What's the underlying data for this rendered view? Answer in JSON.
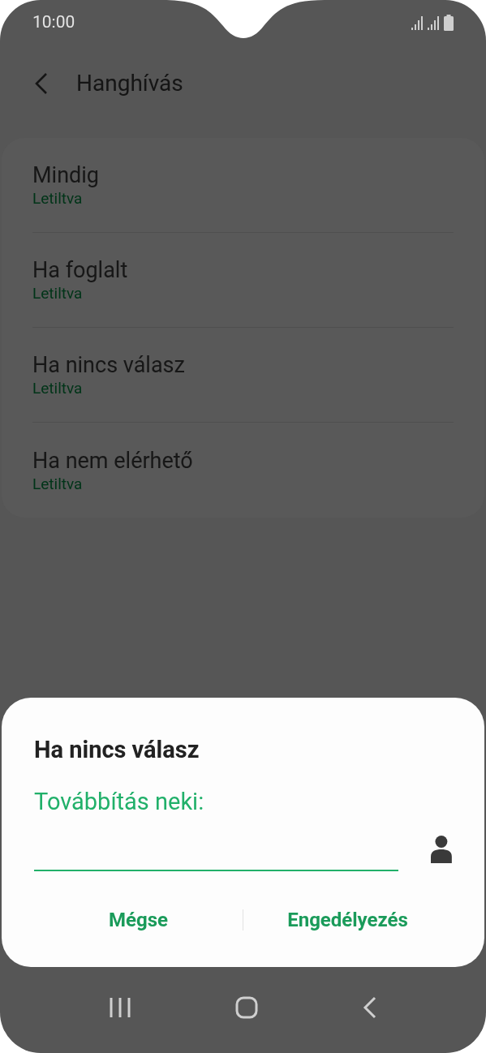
{
  "status_bar": {
    "time": "10:00"
  },
  "header": {
    "title": "Hanghívás"
  },
  "items": [
    {
      "title": "Mindig",
      "subtitle": "Letiltva"
    },
    {
      "title": "Ha foglalt",
      "subtitle": "Letiltva"
    },
    {
      "title": "Ha nincs válasz",
      "subtitle": "Letiltva"
    },
    {
      "title": "Ha nem elérhető",
      "subtitle": "Letiltva"
    }
  ],
  "dialog": {
    "title": "Ha nincs válasz",
    "field_label": "Továbbítás neki:",
    "buttons": [
      "Mégse",
      "Engedélyezés"
    ]
  }
}
